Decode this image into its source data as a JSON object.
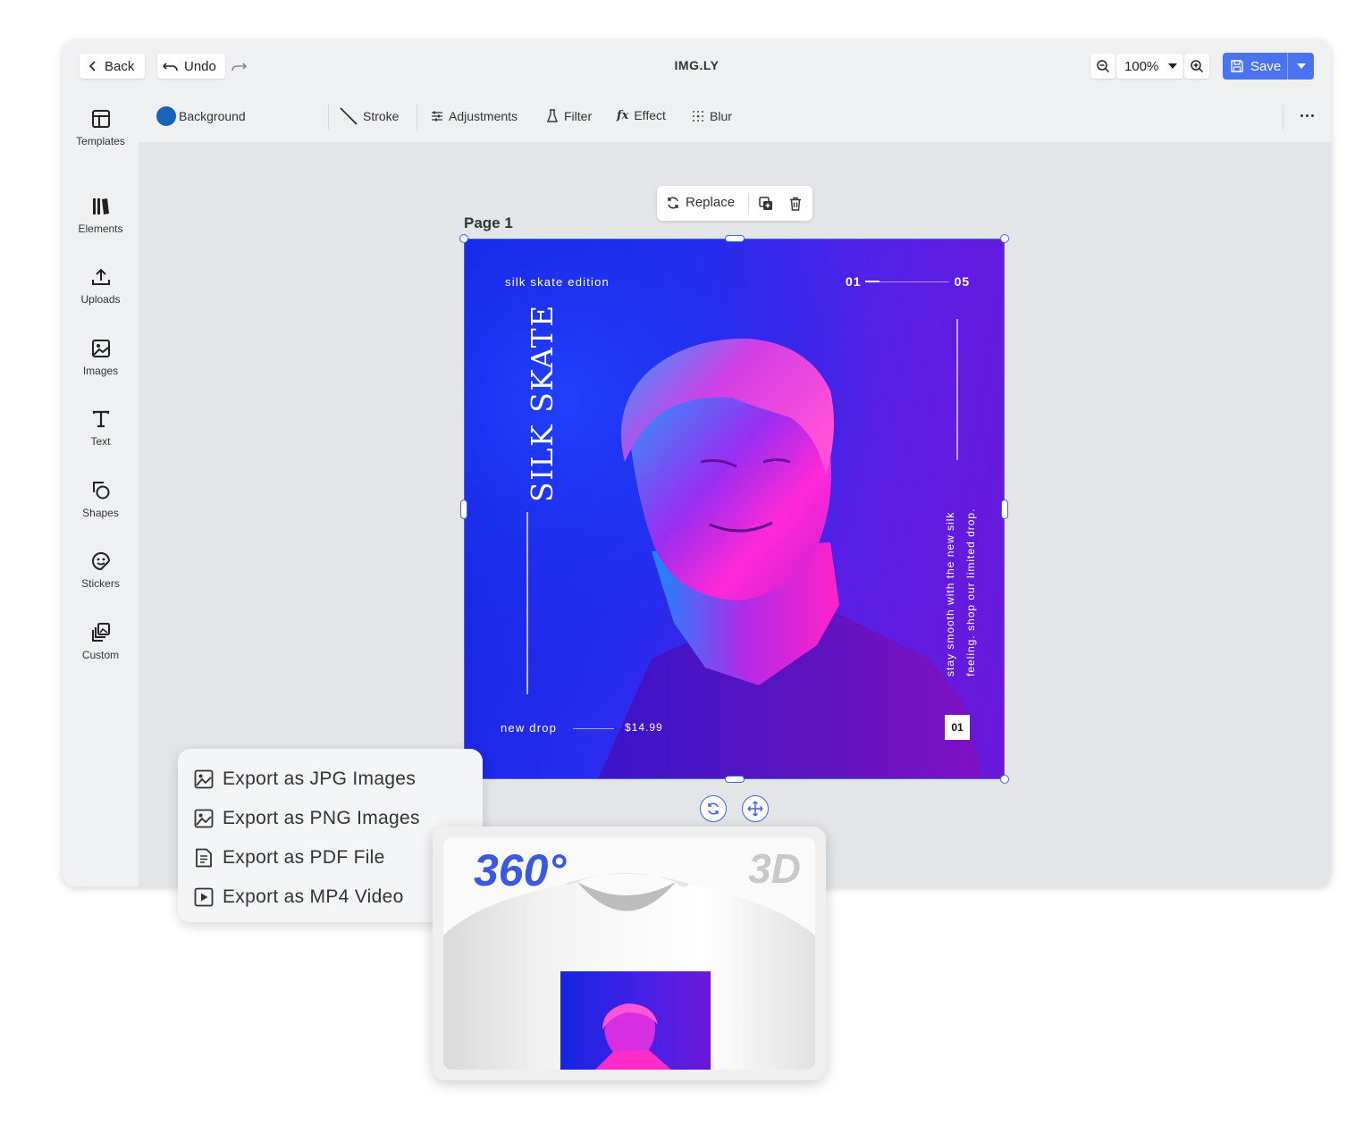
{
  "topbar": {
    "back_label": "Back",
    "undo_label": "Undo",
    "title": "IMG.LY",
    "zoom_value": "100%",
    "save_label": "Save"
  },
  "sidebar": {
    "items": [
      {
        "label": "Templates",
        "icon": "templates-icon"
      },
      {
        "label": "Elements",
        "icon": "elements-icon"
      },
      {
        "label": "Uploads",
        "icon": "upload-icon"
      },
      {
        "label": "Images",
        "icon": "image-icon"
      },
      {
        "label": "Text",
        "icon": "text-icon"
      },
      {
        "label": "Shapes",
        "icon": "shapes-icon"
      },
      {
        "label": "Stickers",
        "icon": "sticker-icon"
      },
      {
        "label": "Custom",
        "icon": "custom-icon"
      }
    ]
  },
  "toolbar": {
    "background_label": "Background",
    "background_color": "#1a62b8",
    "stroke_label": "Stroke",
    "adjustments_label": "Adjustments",
    "filter_label": "Filter",
    "effect_label": "Effect",
    "blur_label": "Blur"
  },
  "canvas": {
    "page_label": "Page 1",
    "replace_label": "Replace"
  },
  "poster": {
    "edition": "silk skate edition",
    "page_start": "01",
    "page_end": "05",
    "headline": "SILK SKATE",
    "side_text_line1": "stay smooth with the new silk",
    "side_text_line2": "feeling. shop our limited drop.",
    "new_drop": "new drop",
    "price": "$14.99",
    "badge": "01"
  },
  "export_menu": {
    "items": [
      {
        "label": "Export as JPG Images",
        "icon": "image-file-icon"
      },
      {
        "label": "Export as PNG Images",
        "icon": "image-file-icon"
      },
      {
        "label": "Export as PDF File",
        "icon": "pdf-file-icon"
      },
      {
        "label": "Export as MP4 Video",
        "icon": "video-file-icon"
      }
    ]
  },
  "preview3d": {
    "rotation_label": "360°",
    "mode_label": "3D"
  },
  "colors": {
    "accent": "#4a73f0",
    "selection": "#3f63ee",
    "poster_blue": "#1326e0",
    "poster_purple": "#6a18d8",
    "magenta": "#ff2bd6"
  }
}
